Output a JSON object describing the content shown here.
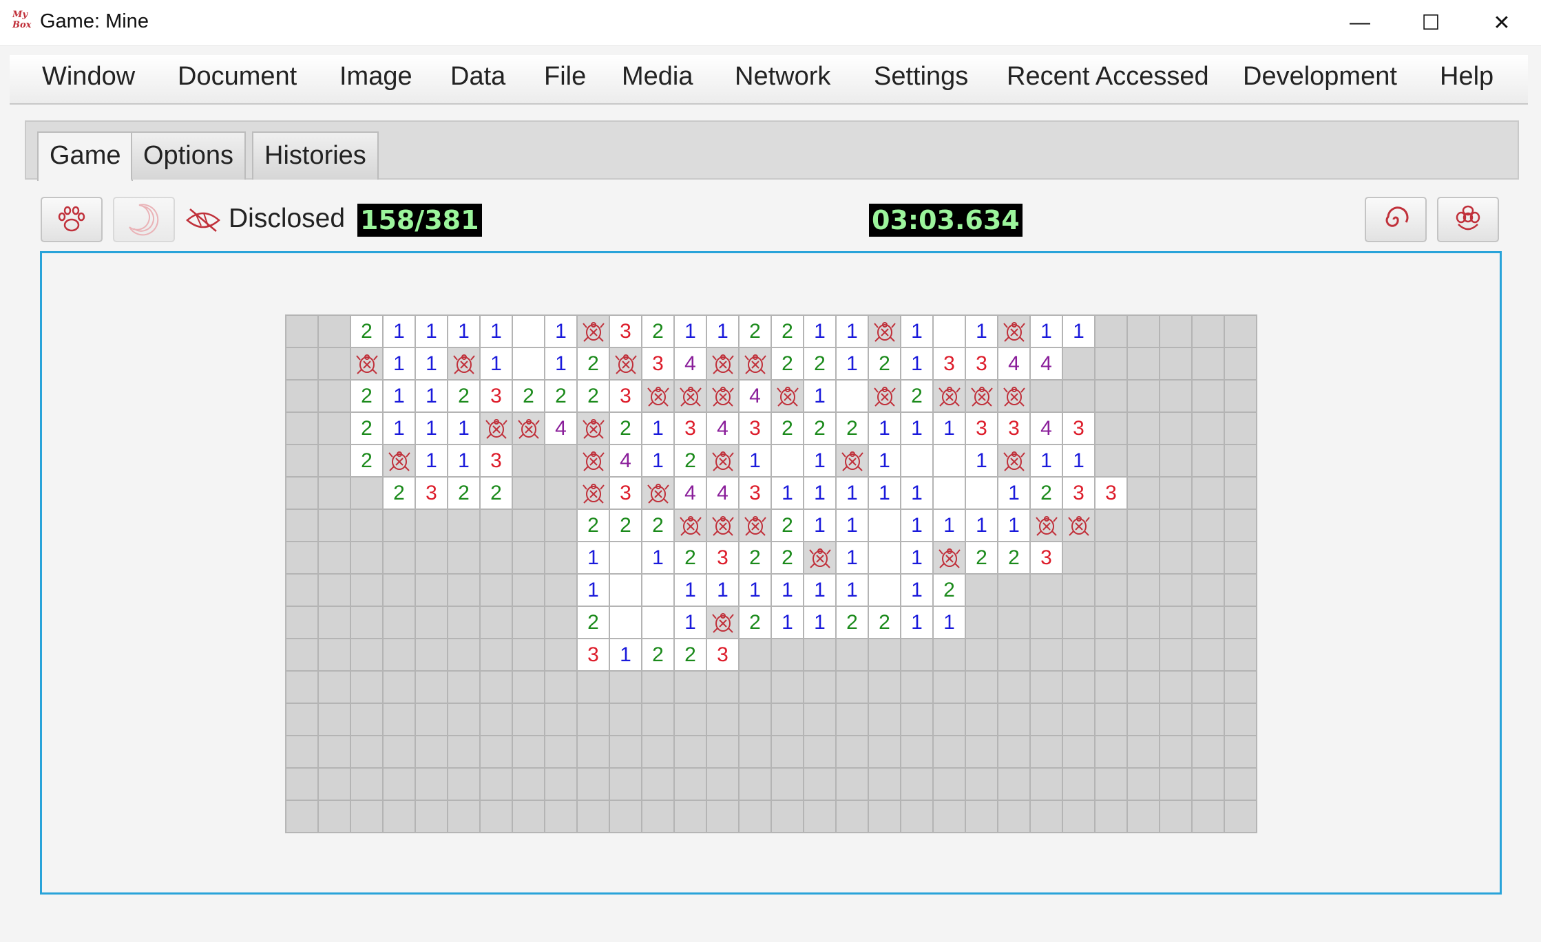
{
  "window": {
    "title": "Game: Mine",
    "logo_text": [
      "My",
      "Box"
    ],
    "controls": {
      "minimize": "—",
      "maximize": "☐",
      "close": "✕"
    }
  },
  "menu": [
    "Window",
    "Document",
    "Image",
    "Data",
    "File",
    "Media",
    "Network",
    "Settings",
    "Recent Accessed",
    "Development",
    "Help"
  ],
  "tabs": [
    {
      "label": "Game",
      "selected": true
    },
    {
      "label": "Options",
      "selected": false
    },
    {
      "label": "Histories",
      "selected": false
    }
  ],
  "toolbar": {
    "disclosed_label": "Disclosed",
    "disclosed_value": "158/381",
    "timer": "03:03.634",
    "buttons": [
      "paw-icon",
      "moon-icon",
      "swirl-icon",
      "flower-icon"
    ],
    "disclosed_icon": "eye-slash-icon"
  },
  "colors": {
    "n1": "#1a1adb",
    "n2": "#1b8a1b",
    "n3": "#dd1c2a",
    "n4": "#8a1e9a",
    "mine": "#c0303a",
    "accent": "#29a3d9",
    "counter_fg": "#9cf59c"
  },
  "board": {
    "columns": 30,
    "rows": 16,
    "legend": {
      ".": "covered",
      "0": "open-empty",
      "M": "mine",
      "1-4": "number"
    },
    "grid": [
      "..2111101M32112211M101M11.....",
      "..M11M1012M34MM22121334 4.....",
      "..211232223MMM4M10M2MMM.....",
      "..2111MM4M213432221113343.....",
      "..2M113..M412M101M1001M11.....",
      "...2322..M3M443111110012 33.....",
      ".........222MMM21101111MM.....",
      ".........1012322M101M223......",
      ".........10011111101 2........",
      ".........2001M211221 1........",
      ".........31223................",
      "..............................",
      "..............................",
      "..............................",
      "..............................",
      ".............................."
    ]
  }
}
